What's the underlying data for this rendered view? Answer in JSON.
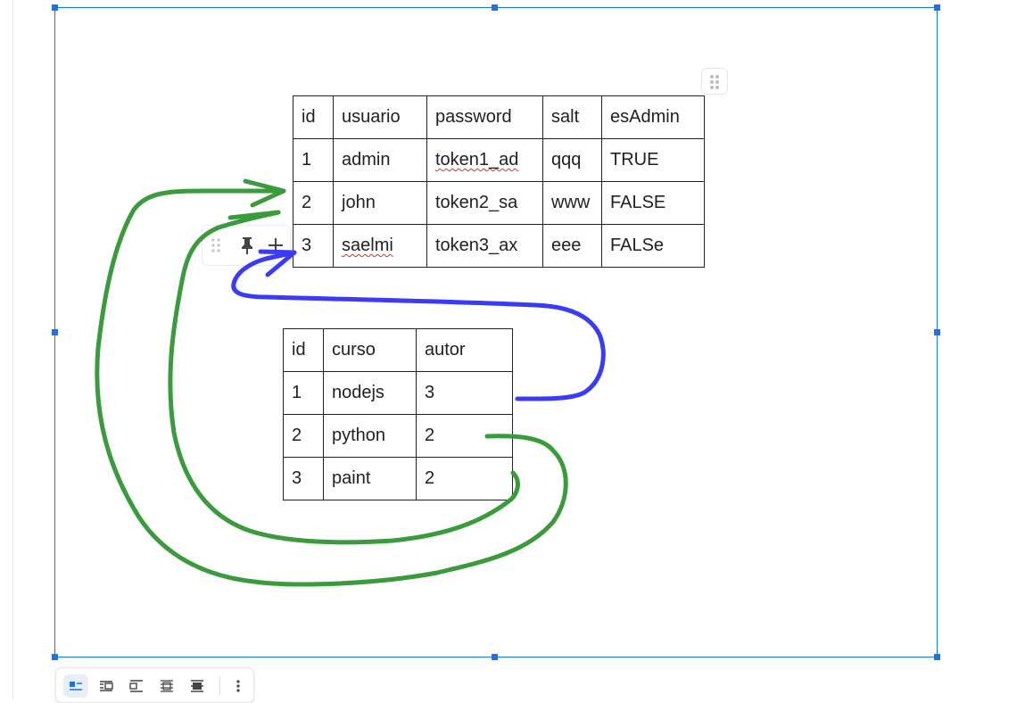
{
  "users_table": {
    "header": [
      "id",
      "usuario",
      "password",
      "salt",
      "esAdmin"
    ],
    "rows": [
      [
        "1",
        "admin",
        "token1_ad",
        "qqq",
        "TRUE"
      ],
      [
        "2",
        "john",
        "token2_sa",
        "www",
        "FALSE"
      ],
      [
        "3",
        "saelmi",
        "token3_ax",
        "eee",
        "FALSe"
      ]
    ]
  },
  "courses_table": {
    "header": [
      "id",
      "curso",
      "autor"
    ],
    "rows": [
      [
        "1",
        "nodejs",
        "3"
      ],
      [
        "2",
        "python",
        "2"
      ],
      [
        "3",
        "paint",
        "2"
      ]
    ]
  },
  "annotation_colors": {
    "green": "#3a9b3d",
    "blue": "#3b3bf5"
  },
  "selection_color": "#1a73e8",
  "toolbar": {
    "buttons": [
      "wrap-inline-icon",
      "wrap-text-icon",
      "break-text-icon",
      "behind-text-icon",
      "in-front-text-icon"
    ],
    "more": "more-vert-icon"
  },
  "row_tools": [
    "drag-icon",
    "pin-icon",
    "plus-icon"
  ]
}
